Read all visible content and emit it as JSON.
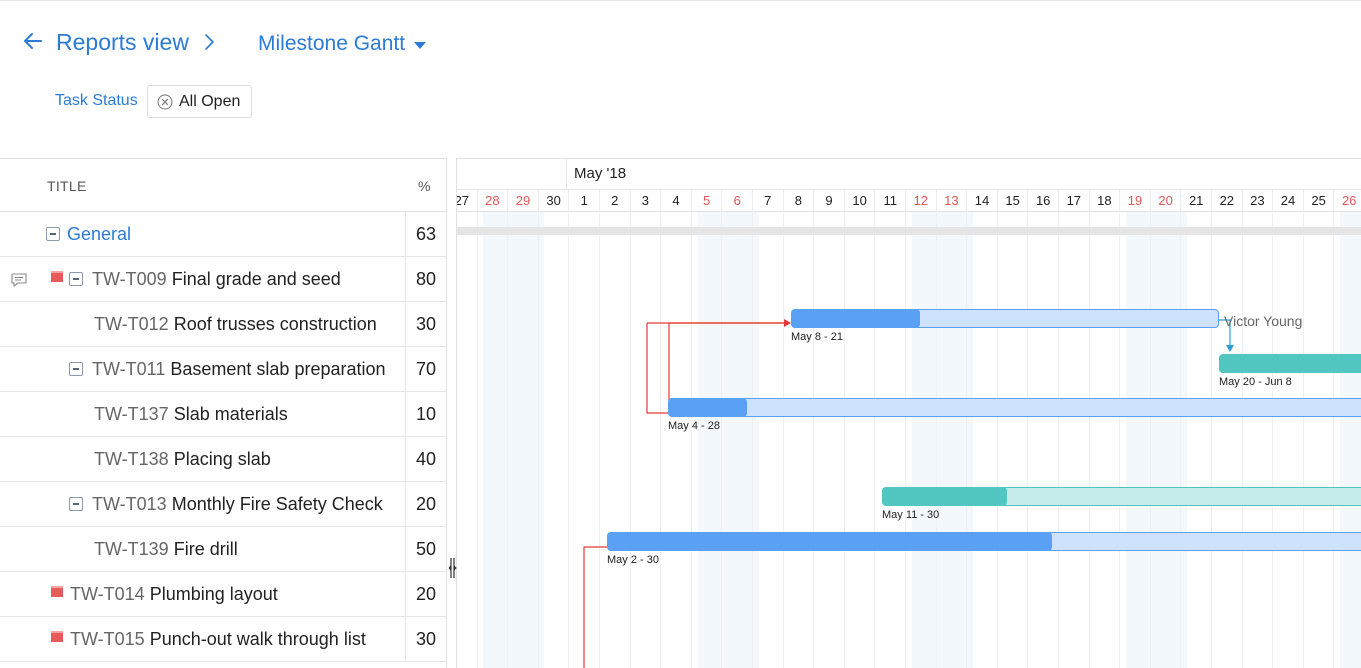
{
  "header": {
    "back_icon": "arrow-left-icon",
    "breadcrumb": "Reports view",
    "view_title": "Milestone Gantt",
    "filter_label": "Task Status",
    "filter_value": "All Open"
  },
  "columns": {
    "title": "TITLE",
    "percent": "%"
  },
  "rows": [
    {
      "id": "",
      "name": "General",
      "pct": "63",
      "type": "group"
    },
    {
      "id": "TW-T009",
      "name": "Final grade and seed",
      "pct": "80"
    },
    {
      "id": "TW-T012",
      "name": "Roof trusses construction",
      "pct": "30"
    },
    {
      "id": "TW-T011",
      "name": "Basement slab preparation",
      "pct": "70"
    },
    {
      "id": "TW-T137",
      "name": "Slab materials",
      "pct": "10"
    },
    {
      "id": "TW-T138",
      "name": "Placing slab",
      "pct": "40"
    },
    {
      "id": "TW-T013",
      "name": "Monthly Fire Safety Check",
      "pct": "20"
    },
    {
      "id": "TW-T139",
      "name": "Fire drill",
      "pct": "50"
    },
    {
      "id": "TW-T014",
      "name": "Plumbing layout",
      "pct": "20"
    },
    {
      "id": "TW-T015",
      "name": " Punch-out walk through list",
      "pct": "30"
    }
  ],
  "timeline": {
    "month": "May '18",
    "days": [
      "27",
      "28",
      "29",
      "30",
      "1",
      "2",
      "3",
      "4",
      "5",
      "6",
      "7",
      "8",
      "9",
      "10",
      "11",
      "12",
      "13",
      "14",
      "15",
      "16",
      "17",
      "18",
      "19",
      "20",
      "21",
      "22",
      "23",
      "24",
      "25",
      "26"
    ],
    "weekend_days": [
      "28",
      "29",
      "5",
      "6",
      "12",
      "13",
      "19",
      "20",
      "26"
    ]
  },
  "bars": [
    {
      "date_label": "May 8 - 21",
      "assignee": "Victor Young",
      "progress": 0.3,
      "color": "#5aa1f5"
    },
    {
      "date_label": "May 20 - Jun 8",
      "progress": 1.0,
      "color": "#52c6c1"
    },
    {
      "date_label": "May 4 - 28",
      "progress": 0.1,
      "color": "#5aa1f5"
    },
    {
      "date_label": "May 11 - 30",
      "progress": 0.2,
      "color": "#52c6c1"
    },
    {
      "date_label": "May 2 - 30",
      "progress": 0.5,
      "color": "#5aa1f5"
    }
  ],
  "colors": {
    "accent": "#2c7bd6",
    "weekend": "#e25555",
    "flag": "#e85b5b",
    "dependency": "#e53935"
  }
}
